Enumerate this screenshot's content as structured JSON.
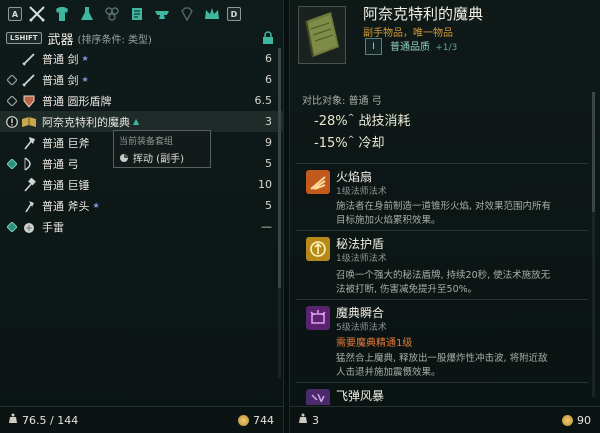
{
  "category_bar": {
    "prev_key": "A",
    "next_key": "D",
    "icons": [
      "crossed-swords-icon",
      "shirt-icon",
      "flask-icon",
      "clover-icon",
      "scroll-icon",
      "anvil-icon",
      "gem-icon",
      "crown-icon"
    ]
  },
  "sort_bar": {
    "key": "LSHIFT",
    "title": "武器",
    "condition": "(排序条件: 类型)"
  },
  "items": [
    {
      "name": "普通 剑",
      "weight": "6",
      "icon": "sword-icon",
      "mark": "none",
      "star": true
    },
    {
      "name": "普通 剑",
      "weight": "6",
      "icon": "sword-icon",
      "mark": "diamond",
      "star": true
    },
    {
      "name": "普通 圆形盾牌",
      "weight": "6.5",
      "icon": "round-shield-icon",
      "mark": "diamond",
      "star": false
    },
    {
      "name": "阿奈克特利的魔典",
      "weight": "3",
      "icon": "spellbook-icon",
      "mark": "exclamation",
      "star": false,
      "selected": true
    },
    {
      "name": "普通 巨斧",
      "weight": "9",
      "icon": "greataxe-icon",
      "mark": "none",
      "star": false
    },
    {
      "name": "普通 弓",
      "weight": "5",
      "icon": "bow-icon",
      "mark": "diamond-green",
      "star": false
    },
    {
      "name": "普通 巨锤",
      "weight": "10",
      "icon": "greathammer-icon",
      "mark": "none",
      "star": false
    },
    {
      "name": "普通 斧头",
      "weight": "5",
      "icon": "axe-icon",
      "mark": "none",
      "star": true
    },
    {
      "name": "手雷",
      "weight": "—",
      "icon": "grenade-icon",
      "mark": "diamond-green",
      "star": false
    }
  ],
  "tooltip": {
    "header": "当前装备套组",
    "line": "挥动 (副手)"
  },
  "left_footer": {
    "weight": "76.5 / 144",
    "gold": "744"
  },
  "detail": {
    "title": "阿奈克特利的魔典",
    "subtitle": "副手物品，唯一物品",
    "tier": "I",
    "quality": "普通品质",
    "quality_frac": "+1/3",
    "compare_label": "对比对象:  普通 弓",
    "stats": [
      {
        "value": "-28%",
        "label": "战技消耗"
      },
      {
        "value": "-15%",
        "label": "冷却"
      }
    ],
    "skills": [
      {
        "name": "火焰扇",
        "type": "1级法师法术",
        "req": "",
        "desc": [
          "施法者在身前制造一道锥形火焰, 对效果范围内所有",
          "目标施加火焰累积效果。"
        ],
        "icon": "fire-fan-icon",
        "color": "#c25a1e"
      },
      {
        "name": "秘法护盾",
        "type": "1级法师法术",
        "req": "",
        "desc": [
          "召唤一个强大的秘法盾牌, 持续20秒, 使法术施放无",
          "法被打断, 伤害减免提升至50%。"
        ],
        "icon": "arcane-shield-icon",
        "color": "#b58a1a"
      },
      {
        "name": "魔典瞬合",
        "type": "5级法师法术",
        "req": "需要魔典精通1级",
        "desc": [
          "猛然合上魔典, 释放出一股爆炸性冲击波, 将附近敌",
          "人击退并施加震慑效果。"
        ],
        "icon": "tome-slam-icon",
        "color": "#5a2370"
      },
      {
        "name": "飞弹风暴",
        "type": "",
        "req": "",
        "desc": [],
        "icon": "missile-storm-icon",
        "color": "#4a2a6a"
      }
    ]
  },
  "right_footer": {
    "weight": "3",
    "gold": "90"
  },
  "colors": {
    "accent_teal": "#8fd1c2",
    "accent_orange": "#e07a3a",
    "unique_gold": "#d19a3b"
  }
}
